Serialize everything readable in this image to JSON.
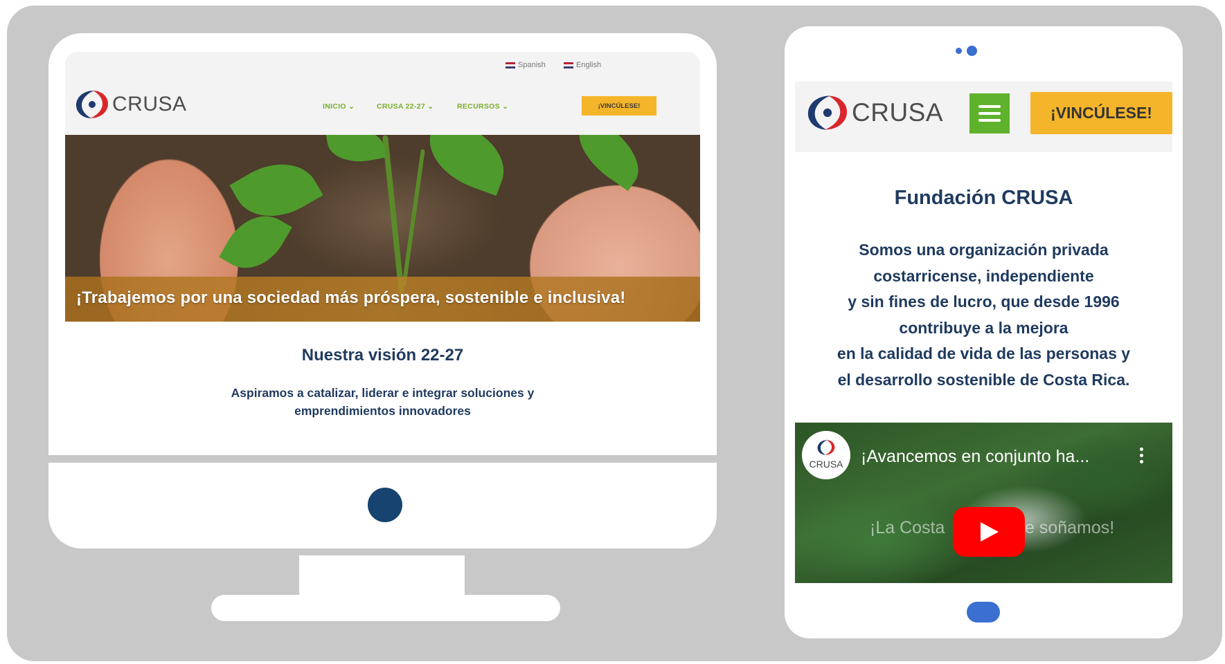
{
  "desktop": {
    "languages": [
      "Spanish",
      "English"
    ],
    "logo_text": "CRUSA",
    "nav": [
      "INICIO ⌄",
      "CRUSA 22-27 ⌄",
      "RECURSOS ⌄"
    ],
    "cta": "¡VINCÚLESE!",
    "hero_text": "¡Trabajemos por una sociedad más próspera, sostenible e inclusiva!",
    "section_title": "Nuestra visión 22-27",
    "body_lines": [
      "Aspiramos a catalizar, liderar e integrar soluciones y",
      "emprendimientos innovadores"
    ]
  },
  "mobile": {
    "logo_text": "CRUSA",
    "cta": "¡VINCÚLESE!",
    "title": "Fundación CRUSA",
    "body_lines": [
      "Somos una organización privada",
      "costarricense, independiente",
      "y sin fines de lucro, que desde 1996",
      "contribuye a la mejora",
      "en la calidad de vida de las personas y",
      "el desarrollo sostenible de Costa Rica."
    ],
    "video": {
      "channel_label": "CRUSA",
      "title": "¡Avancemos en conjunto ha...",
      "overlay_left": "¡La Costa",
      "overlay_right": "e soñamos!"
    }
  },
  "colors": {
    "background": "#c8c8c8",
    "navy": "#1f3a5f",
    "accent_yellow": "#f5b52a",
    "accent_green": "#5fb22c",
    "camera_dot": "#16436f",
    "phone_accent": "#3b6fd0",
    "youtube_red": "#ff0000"
  }
}
